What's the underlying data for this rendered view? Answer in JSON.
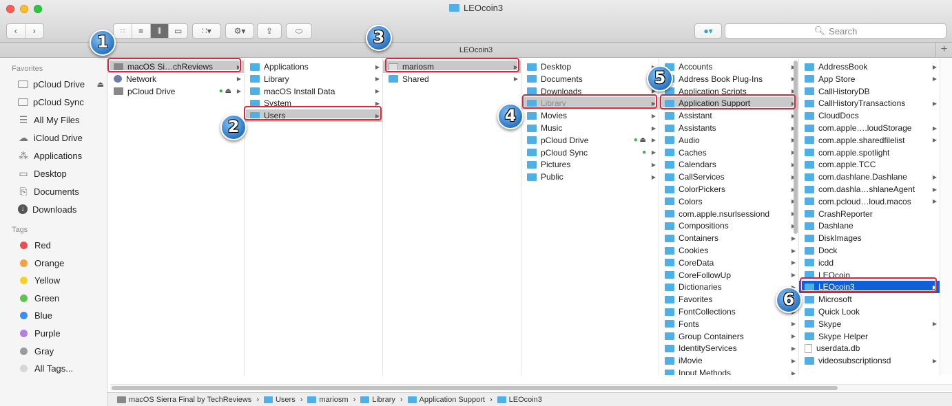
{
  "window": {
    "title": "LEOcoin3"
  },
  "toolbar": {
    "share_icon": "share-icon",
    "gear_icon": "gear-icon"
  },
  "search": {
    "placeholder": "Search"
  },
  "pathbar": {
    "title": "LEOcoin3",
    "plus": "+"
  },
  "sidebar": {
    "favorites_header": "Favorites",
    "favorites": [
      {
        "label": "pCloud Drive",
        "icon": "folder-icon",
        "eject": "⏏"
      },
      {
        "label": "pCloud Sync",
        "icon": "folder-icon"
      },
      {
        "label": "All My Files",
        "icon": "all-files-icon"
      },
      {
        "label": "iCloud Drive",
        "icon": "cloud-icon"
      },
      {
        "label": "Applications",
        "icon": "applications-icon"
      },
      {
        "label": "Desktop",
        "icon": "desktop-icon"
      },
      {
        "label": "Documents",
        "icon": "documents-icon"
      },
      {
        "label": "Downloads",
        "icon": "downloads-icon"
      }
    ],
    "tags_header": "Tags",
    "tags": [
      {
        "label": "Red",
        "color": "#f04b4b"
      },
      {
        "label": "Orange",
        "color": "#f6a03a"
      },
      {
        "label": "Yellow",
        "color": "#f5d029"
      },
      {
        "label": "Green",
        "color": "#5ec350"
      },
      {
        "label": "Blue",
        "color": "#3c8ef3"
      },
      {
        "label": "Purple",
        "color": "#b57ee0"
      },
      {
        "label": "Gray",
        "color": "#9b9b9b"
      },
      {
        "label": "All Tags...",
        "color": "#d6d6d6"
      }
    ]
  },
  "columns": {
    "c1": [
      "macOS Si…chReviews",
      "Network",
      "pCloud Drive"
    ],
    "c2": [
      "Applications",
      "Library",
      "macOS Install Data",
      "System",
      "Users"
    ],
    "c3": [
      "mariosm",
      "Shared"
    ],
    "c4": [
      "Desktop",
      "Documents",
      "Downloads",
      "Library",
      "Movies",
      "Music",
      "pCloud Drive",
      "pCloud Sync",
      "Pictures",
      "Public"
    ],
    "c5": [
      "Accounts",
      "Address Book Plug-Ins",
      "Application Scripts",
      "Application Support",
      "Assistant",
      "Assistants",
      "Audio",
      "Caches",
      "Calendars",
      "CallServices",
      "ColorPickers",
      "Colors",
      "com.apple.nsurlsessiond",
      "Compositions",
      "Containers",
      "Cookies",
      "CoreData",
      "CoreFollowUp",
      "Dictionaries",
      "Favorites",
      "FontCollections",
      "Fonts",
      "Group Containers",
      "IdentityServices",
      "iMovie",
      "Input Methods"
    ],
    "c6": [
      "AddressBook",
      "App Store",
      "CallHistoryDB",
      "CallHistoryTransactions",
      "CloudDocs",
      "com.apple….loudStorage",
      "com.apple.sharedfilelist",
      "com.apple.spotlight",
      "com.apple.TCC",
      "com.dashlane.Dashlane",
      "com.dashla…shlaneAgent",
      "com.pcloud…loud.macos",
      "CrashReporter",
      "Dashlane",
      "DiskImages",
      "Dock",
      "icdd",
      "LEOcoin",
      "LEOcoin3",
      "Microsoft",
      "Quick Look",
      "Skype",
      "Skype Helper",
      "userdata.db",
      "videosubscriptionsd"
    ]
  },
  "steps": [
    "1",
    "2",
    "3",
    "4",
    "5",
    "6"
  ],
  "statusbar": {
    "path": [
      "macOS Sierra Final by TechReviews",
      "Users",
      "mariosm",
      "Library",
      "Application Support",
      "LEOcoin3"
    ],
    "separator": "›"
  }
}
